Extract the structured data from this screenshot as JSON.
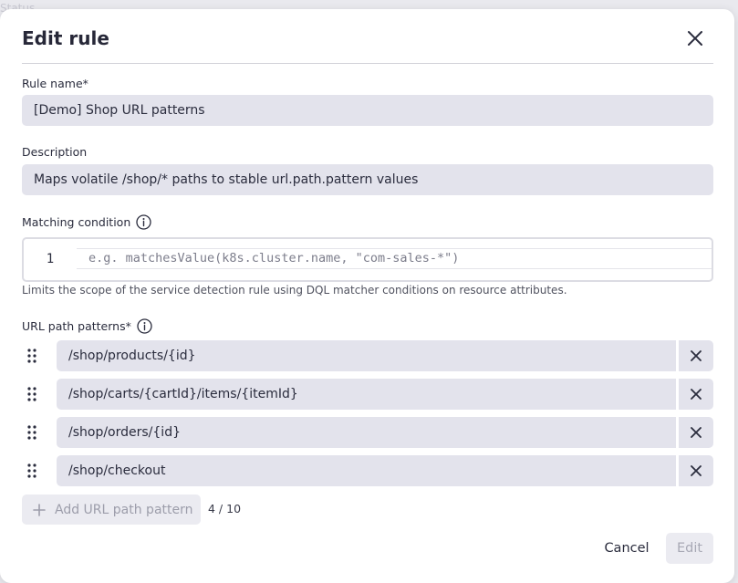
{
  "background": {
    "text": "Status"
  },
  "dialog": {
    "title": "Edit rule",
    "close_icon": "close-icon"
  },
  "rule_name": {
    "label": "Rule name*",
    "value": "[Demo] Shop URL patterns"
  },
  "description": {
    "label": "Description",
    "value": "Maps volatile /shop/* paths to stable url.path.pattern values"
  },
  "matching_condition": {
    "label": "Matching condition",
    "line_number": "1",
    "placeholder": "e.g. matchesValue(k8s.cluster.name, \"com-sales-*\")",
    "hint": "Limits the scope of the service detection rule using DQL matcher conditions on resource attributes."
  },
  "url_patterns": {
    "label": "URL path patterns*",
    "items": [
      {
        "value": "/shop/products/{id}"
      },
      {
        "value": "/shop/carts/{cartId}/items/{itemId}"
      },
      {
        "value": "/shop/orders/{id}"
      },
      {
        "value": "/shop/checkout"
      }
    ],
    "add_label": "Add URL path pattern",
    "counter": "4 / 10"
  },
  "footer": {
    "cancel_label": "Cancel",
    "edit_label": "Edit"
  },
  "colors": {
    "field_bg": "#e3e3ec",
    "text": "#2a2c3d",
    "disabled_text": "#a8a9b5"
  }
}
